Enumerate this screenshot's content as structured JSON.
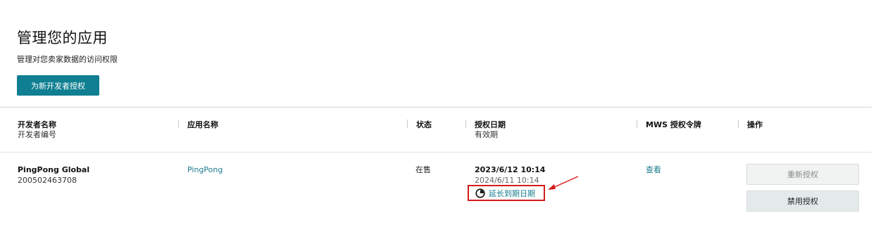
{
  "header": {
    "title": "管理您的应用",
    "subtitle": "管理对您卖家数据的访问权限",
    "primary_button": "为新开发者授权"
  },
  "table": {
    "columns": [
      {
        "label": "开发者名称",
        "sub": "开发者编号"
      },
      {
        "label": "应用名称",
        "sub": ""
      },
      {
        "label": "状态",
        "sub": ""
      },
      {
        "label": "授权日期",
        "sub": "有效期"
      },
      {
        "label": "MWS 授权令牌",
        "sub": ""
      },
      {
        "label": "操作",
        "sub": ""
      }
    ],
    "rows": [
      {
        "developer_name": "PingPong Global",
        "developer_id": "200502463708",
        "app_name": "PingPong",
        "status": "在售",
        "auth_date": "2023/6/12 10:14",
        "expiry_date": "2024/6/11 10:14",
        "extend_label": "延长到期日期",
        "mws_token_label": "查看",
        "actions": {
          "reauthorize": "重新授权",
          "disable": "禁用授权"
        }
      }
    ]
  },
  "colors": {
    "accent": "#0f7f91",
    "link": "#1a7c8e",
    "highlight": "#d51b1b"
  },
  "icons": {
    "extend": "clock-icon",
    "annotation": "arrow-icon"
  }
}
